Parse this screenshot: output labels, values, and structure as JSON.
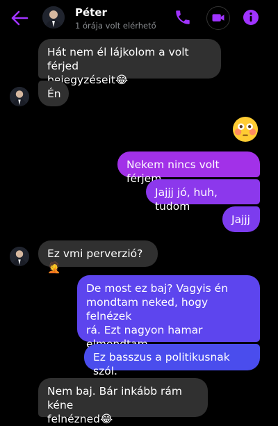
{
  "header": {
    "contact_name": "Péter",
    "status": "1 órája volt elérhető",
    "icons": [
      "back-arrow-icon",
      "phone-icon",
      "video-call-icon",
      "info-icon"
    ],
    "accent_color": "#a033ff"
  },
  "messages": [
    {
      "sender": "Péter",
      "text": "Hát nem él lájkolom a volt férjed\nbejegyzéseit😂"
    },
    {
      "sender": "Péter",
      "text": "Én"
    },
    {
      "sender": "me",
      "emoji": "flushed-face"
    },
    {
      "sender": "me",
      "text": "Nekem nincs volt férjem"
    },
    {
      "sender": "me",
      "text": "Jajjj jó, huh, tudom"
    },
    {
      "sender": "me",
      "text": "Jajjj"
    },
    {
      "sender": "Péter",
      "text": "Ez vmi perverzió?🤦"
    },
    {
      "sender": "me",
      "text": "De most ez baj? Vagyis én\nmondtam neked, hogy felnézek\nrá. Ezt nagyon hamar\nelmondtam"
    },
    {
      "sender": "me",
      "text": "Ez basszus a politikusnak szól."
    },
    {
      "sender": "Péter",
      "text": "Nem baj. Bár inkább rám kéne\nfelnézned😂"
    }
  ],
  "colors": {
    "incoming_bubble": "#303030",
    "outgoing_gradient_top": "#a431e6",
    "outgoing_gradient_bottom": "#2f55e8"
  }
}
